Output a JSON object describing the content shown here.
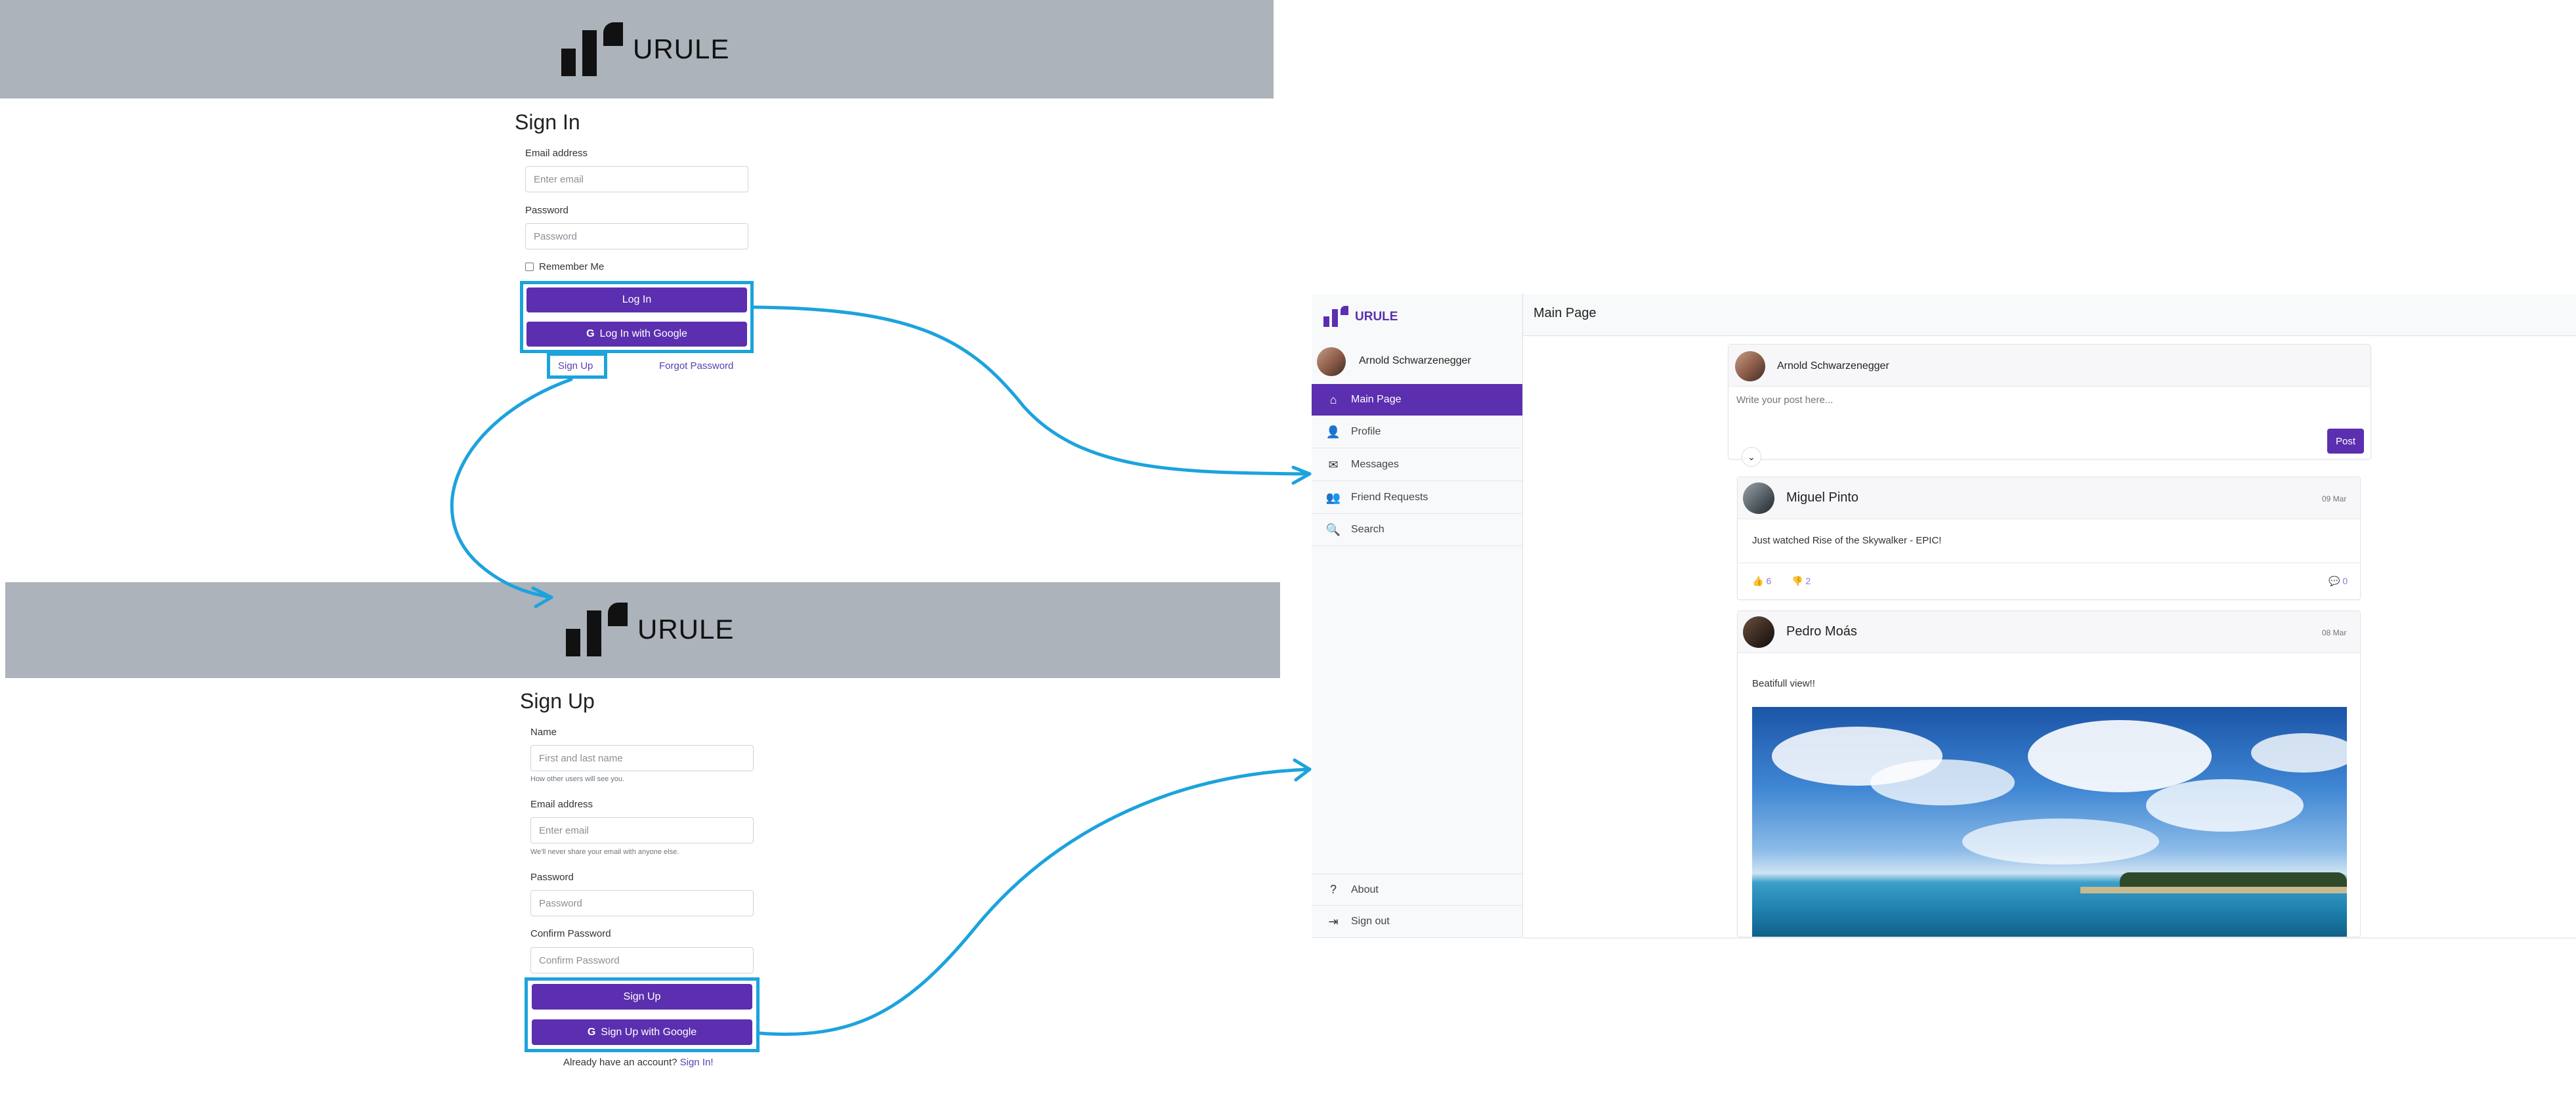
{
  "brand": {
    "name": "URULE"
  },
  "signin": {
    "title": "Sign In",
    "email_label": "Email address",
    "email_placeholder": "Enter email",
    "password_label": "Password",
    "password_placeholder": "Password",
    "remember_label": "Remember Me",
    "login_button": "Log In",
    "google_button": "Log In with Google",
    "signup_link": "Sign Up",
    "forgot_link": "Forgot Password"
  },
  "signup": {
    "title": "Sign Up",
    "name_label": "Name",
    "name_placeholder": "First and last name",
    "name_hint": "How other users will see you.",
    "email_label": "Email address",
    "email_placeholder": "Enter email",
    "email_hint": "We'll never share your email with anyone else.",
    "password_label": "Password",
    "password_placeholder": "Password",
    "confirm_label": "Confirm Password",
    "confirm_placeholder": "Confirm Password",
    "signup_button": "Sign Up",
    "google_button": "Sign Up with Google",
    "have_account": "Already have an account?",
    "signin_link": "Sign In!"
  },
  "app": {
    "brand": "URULE",
    "user_name": "Arnold Schwarzenegger",
    "page_title": "Main Page",
    "nav": [
      {
        "label": "Main Page",
        "icon": "home-icon"
      },
      {
        "label": "Profile",
        "icon": "user-icon"
      },
      {
        "label": "Messages",
        "icon": "envelope-icon"
      },
      {
        "label": "Friend Requests",
        "icon": "user-plus-icon"
      },
      {
        "label": "Search",
        "icon": "search-icon"
      }
    ],
    "bottom_nav": [
      {
        "label": "About",
        "icon": "question-icon"
      },
      {
        "label": "Sign out",
        "icon": "sign-out-icon"
      }
    ],
    "composer": {
      "user": "Arnold Schwarzenegger",
      "placeholder": "Write your post here...",
      "post_button": "Post"
    },
    "posts": [
      {
        "author": "Miguel Pinto",
        "date": "09 Mar",
        "text": "Just watched Rise of the Skywalker - EPIC!",
        "likes": "6",
        "dislikes": "2",
        "comments": "0"
      },
      {
        "author": "Pedro Moás",
        "date": "08 Mar",
        "text": "Beatifull view!!"
      }
    ]
  },
  "colors": {
    "accent": "#5b2faf",
    "arrow": "#1ca3dd",
    "banner": "#acb3ba"
  }
}
